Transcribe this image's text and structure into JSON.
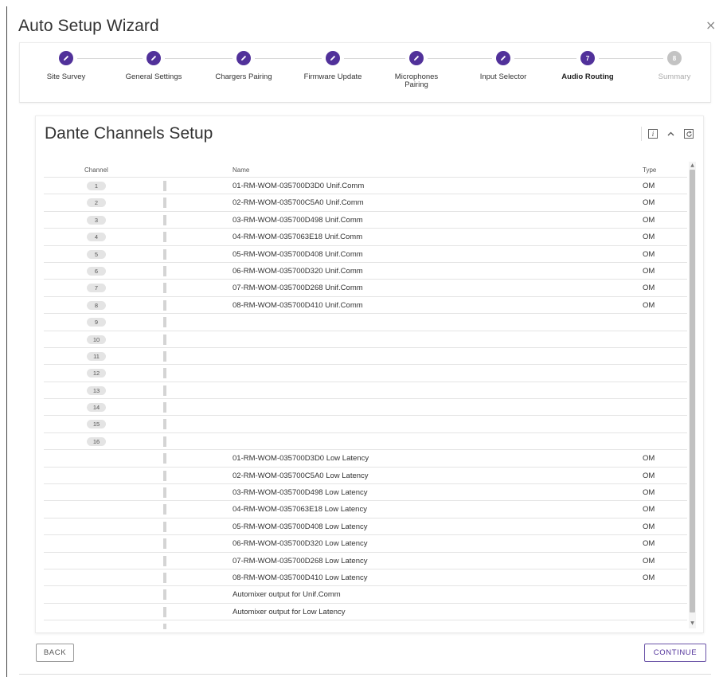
{
  "wizard": {
    "title": "Auto Setup Wizard",
    "close_glyph": "×"
  },
  "steps": [
    {
      "label": "Site Survey",
      "state": "done",
      "icon": "pencil-icon"
    },
    {
      "label": "General Settings",
      "state": "done",
      "icon": "pencil-icon"
    },
    {
      "label": "Chargers Pairing",
      "state": "done",
      "icon": "pencil-icon"
    },
    {
      "label": "Firmware Update",
      "state": "done",
      "icon": "pencil-icon"
    },
    {
      "label": "Microphones Pairing",
      "state": "done",
      "icon": "pencil-icon"
    },
    {
      "label": "Input Selector",
      "state": "done",
      "icon": "pencil-icon"
    },
    {
      "label": "Audio Routing",
      "state": "current",
      "number": "7"
    },
    {
      "label": "Summary",
      "state": "future",
      "number": "8"
    }
  ],
  "panel": {
    "title": "Dante Channels Setup",
    "icons": [
      "info-icon",
      "chevron-up-icon",
      "refresh-icon"
    ],
    "info_glyph": "i",
    "chevron_glyph": "^"
  },
  "table": {
    "headers": {
      "channel": "Channel",
      "name": "Name",
      "type": "Type"
    },
    "rows": [
      {
        "channel": "1",
        "name": "01-RM-WOM-035700D3D0 Unif.Comm",
        "type": "OM"
      },
      {
        "channel": "2",
        "name": "02-RM-WOM-035700C5A0 Unif.Comm",
        "type": "OM"
      },
      {
        "channel": "3",
        "name": "03-RM-WOM-035700D498 Unif.Comm",
        "type": "OM"
      },
      {
        "channel": "4",
        "name": "04-RM-WOM-0357063E18 Unif.Comm",
        "type": "OM"
      },
      {
        "channel": "5",
        "name": "05-RM-WOM-035700D408 Unif.Comm",
        "type": "OM"
      },
      {
        "channel": "6",
        "name": "06-RM-WOM-035700D320 Unif.Comm",
        "type": "OM"
      },
      {
        "channel": "7",
        "name": "07-RM-WOM-035700D268 Unif.Comm",
        "type": "OM"
      },
      {
        "channel": "8",
        "name": "08-RM-WOM-035700D410 Unif.Comm",
        "type": "OM"
      },
      {
        "channel": "9",
        "name": "",
        "type": ""
      },
      {
        "channel": "10",
        "name": "",
        "type": ""
      },
      {
        "channel": "11",
        "name": "",
        "type": ""
      },
      {
        "channel": "12",
        "name": "",
        "type": ""
      },
      {
        "channel": "13",
        "name": "",
        "type": ""
      },
      {
        "channel": "14",
        "name": "",
        "type": ""
      },
      {
        "channel": "15",
        "name": "",
        "type": ""
      },
      {
        "channel": "16",
        "name": "",
        "type": ""
      },
      {
        "channel": "",
        "name": "01-RM-WOM-035700D3D0 Low Latency",
        "type": "OM"
      },
      {
        "channel": "",
        "name": "02-RM-WOM-035700C5A0 Low Latency",
        "type": "OM"
      },
      {
        "channel": "",
        "name": "03-RM-WOM-035700D498 Low Latency",
        "type": "OM"
      },
      {
        "channel": "",
        "name": "04-RM-WOM-0357063E18 Low Latency",
        "type": "OM"
      },
      {
        "channel": "",
        "name": "05-RM-WOM-035700D408 Low Latency",
        "type": "OM"
      },
      {
        "channel": "",
        "name": "06-RM-WOM-035700D320 Low Latency",
        "type": "OM"
      },
      {
        "channel": "",
        "name": "07-RM-WOM-035700D268 Low Latency",
        "type": "OM"
      },
      {
        "channel": "",
        "name": "08-RM-WOM-035700D410 Low Latency",
        "type": "OM"
      },
      {
        "channel": "",
        "name": "Automixer output for Unif.Comm",
        "type": ""
      },
      {
        "channel": "",
        "name": "Automixer output for Low Latency",
        "type": ""
      }
    ]
  },
  "buttons": {
    "back": "BACK",
    "continue": "CONTINUE"
  },
  "colors": {
    "accent": "#51319a",
    "future_step": "#c3c3c3"
  }
}
